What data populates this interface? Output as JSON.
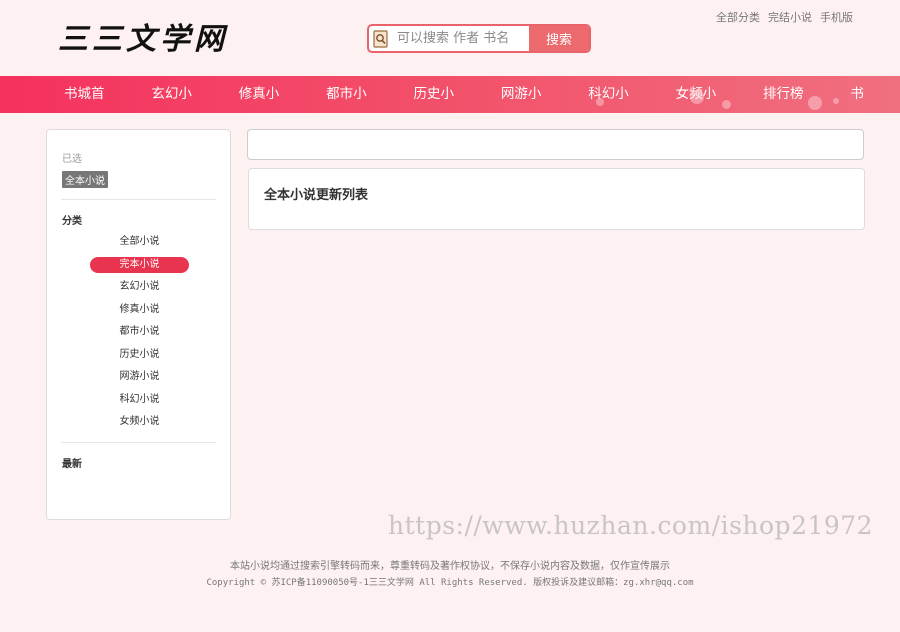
{
  "header": {
    "logo": "三三文学网",
    "search": {
      "placeholder": "可以搜索 作者 书名",
      "button_label": "搜索"
    },
    "top_links": [
      "全部分类",
      "完结小说",
      "手机版"
    ]
  },
  "nav": {
    "items": [
      "书城首页",
      "玄幻小说",
      "修真小说",
      "都市小说",
      "历史小说",
      "网游小说",
      "科幻小说",
      "女频小说",
      "排行榜单",
      "书架"
    ]
  },
  "sidebar": {
    "selected_label": "已选",
    "selected_tag": "全本小说",
    "category_heading": "分类",
    "categories": [
      "全部小说",
      "完本小说",
      "玄幻小说",
      "修真小说",
      "都市小说",
      "历史小说",
      "网游小说",
      "科幻小说",
      "女频小说"
    ],
    "active_category": "完本小说",
    "latest_heading": "最新"
  },
  "main": {
    "panel_title": "全本小说更新列表"
  },
  "watermark": "https://www.huzhan.com/ishop21972",
  "footer": {
    "line1": "本站小说均通过搜索引擎转码而来，尊重转码及著作权协议，不保存小说内容及数据，仅作宣传展示",
    "line2": "Copyright © 苏ICP备11090050号-1三三文学网 All Rights Reserved. 版权投诉及建议邮箱：zg.xhr@qq.com"
  },
  "colors": {
    "accent": "#e8344e",
    "nav_start": "#f5315e",
    "nav_end": "#f07080",
    "search_button": "#ec6a6d",
    "background": "#fdf2f1"
  }
}
